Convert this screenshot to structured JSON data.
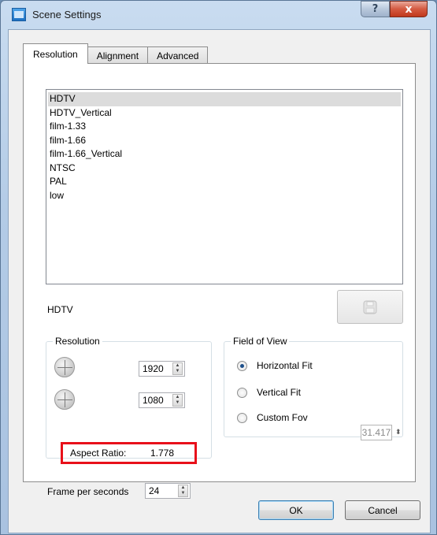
{
  "window": {
    "title": "Scene Settings",
    "help_glyph": "?",
    "close_glyph": "x"
  },
  "tabs": [
    {
      "label": "Resolution",
      "active": true
    },
    {
      "label": "Alignment",
      "active": false
    },
    {
      "label": "Advanced",
      "active": false
    }
  ],
  "presets": {
    "items": [
      "HDTV",
      "HDTV_Vertical",
      "film-1.33",
      "film-1.66",
      "film-1.66_Vertical",
      "NTSC",
      "PAL",
      "low"
    ],
    "selected": "HDTV",
    "current_name": "HDTV"
  },
  "resolution": {
    "group_label": "Resolution",
    "width": "1920",
    "height": "1080",
    "aspect_label": "Aspect Ratio:",
    "aspect_value": "1.778"
  },
  "fov": {
    "group_label": "Field of View",
    "options": [
      {
        "label": "Horizontal Fit",
        "checked": true
      },
      {
        "label": "Vertical Fit",
        "checked": false
      },
      {
        "label": "Custom Fov",
        "checked": false
      }
    ],
    "custom_value": "31.417"
  },
  "fps": {
    "label": "Frame per seconds",
    "value": "24"
  },
  "buttons": {
    "ok": "OK",
    "cancel": "Cancel"
  },
  "colors": {
    "highlight_border": "#e8101a",
    "selected_row": "#dcdcdc"
  }
}
